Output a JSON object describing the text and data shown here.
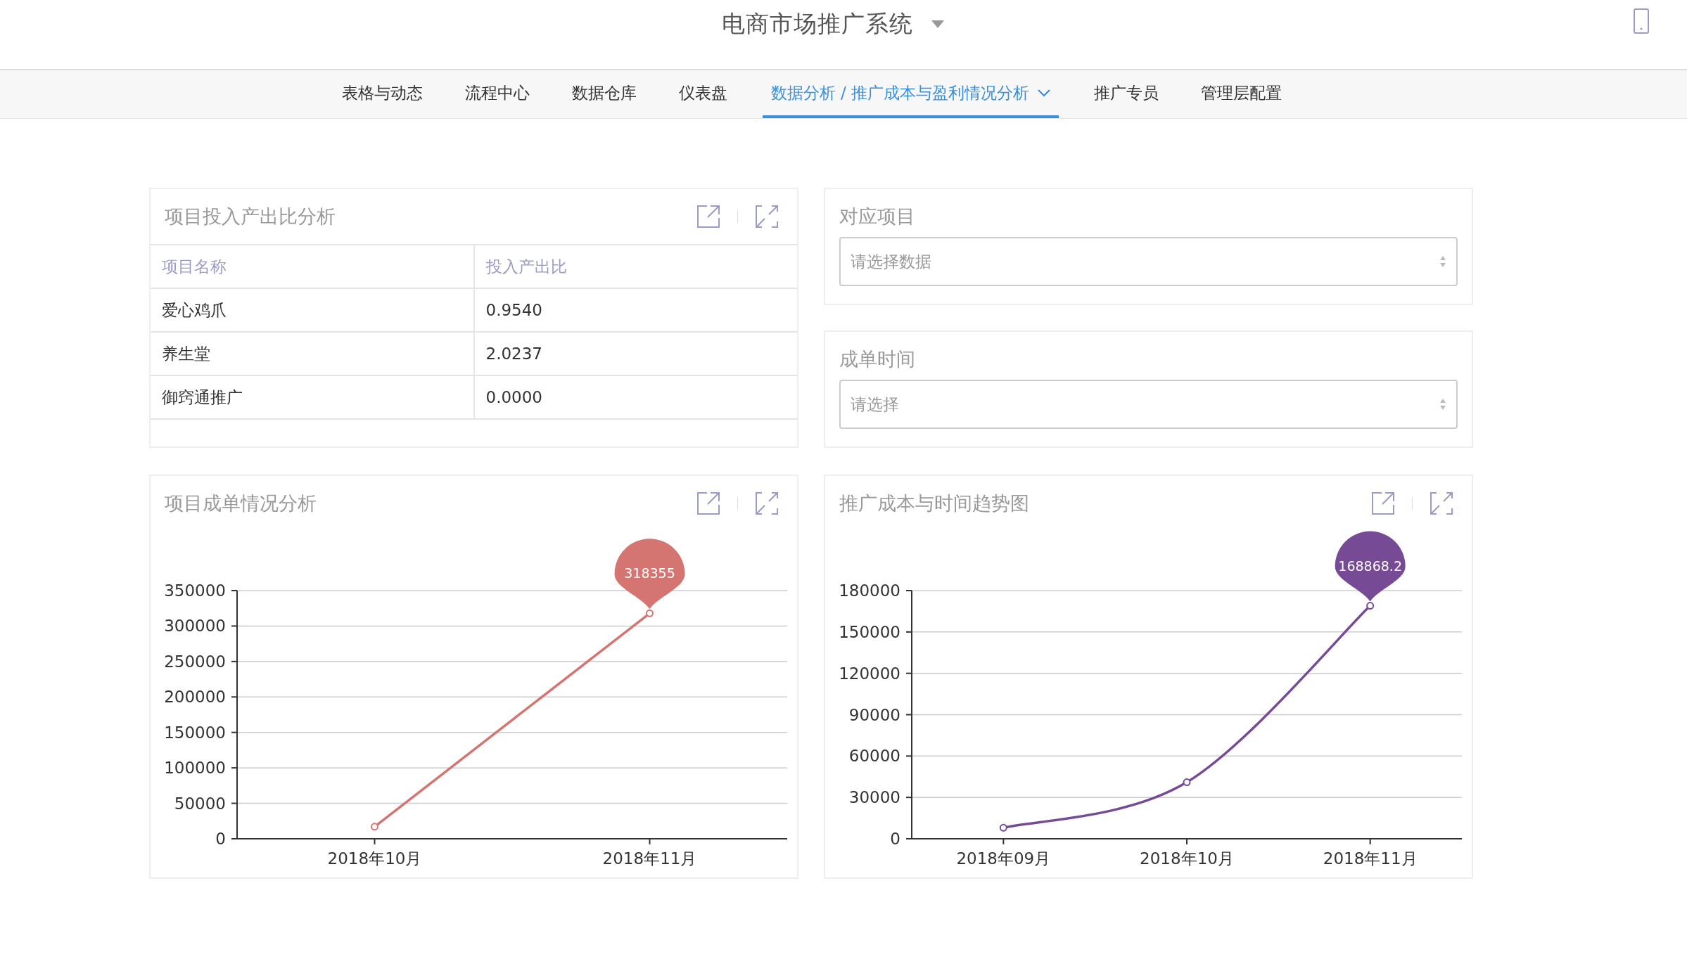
{
  "header": {
    "title": "电商市场推广系统"
  },
  "nav": {
    "tabs": [
      {
        "label": "表格与动态",
        "selected": false
      },
      {
        "label": "流程中心",
        "selected": false
      },
      {
        "label": "数据仓库",
        "selected": false
      },
      {
        "label": "仪表盘",
        "selected": false
      },
      {
        "label": "数据分析 / 推广成本与盈利情况分析",
        "selected": true
      },
      {
        "label": "推广专员",
        "selected": false
      },
      {
        "label": "管理层配置",
        "selected": false
      }
    ]
  },
  "ratio_card": {
    "title": "项目投入产出比分析",
    "columns": [
      "项目名称",
      "投入产出比"
    ],
    "rows": [
      [
        "爱心鸡爪",
        "0.9540"
      ],
      [
        "养生堂",
        "2.0237"
      ],
      [
        "御窍通推广",
        "0.0000"
      ]
    ]
  },
  "filters": [
    {
      "label": "对应项目",
      "placeholder": "请选择数据"
    },
    {
      "label": "成单时间",
      "placeholder": "请选择"
    }
  ],
  "charts": [
    {
      "title": "项目成单情况分析",
      "chart_data": {
        "type": "line",
        "categories": [
          "2018年10月",
          "2018年11月"
        ],
        "series": [
          {
            "color": "#d47572",
            "values": [
              17000,
              318000
            ],
            "marker": "circle"
          }
        ],
        "ylim": [
          0,
          350000
        ],
        "yticks": [
          0,
          50000,
          100000,
          150000,
          200000,
          250000,
          300000,
          350000
        ],
        "grid": true,
        "annotations": [
          {
            "x": "2018年11月",
            "y": 318000,
            "text": "318355"
          }
        ]
      }
    },
    {
      "title": "推广成本与时间趋势图",
      "chart_data": {
        "type": "line",
        "categories": [
          "2018年09月",
          "2018年10月",
          "2018年11月"
        ],
        "series": [
          {
            "color": "#774a96",
            "values": [
              8000,
              41000,
              169000
            ],
            "marker": "circle"
          }
        ],
        "ylim": [
          0,
          180000
        ],
        "yticks": [
          0,
          30000,
          60000,
          90000,
          120000,
          150000,
          180000
        ],
        "grid": true,
        "annotations": [
          {
            "x": "2018年11月",
            "y": 169000,
            "text": "168868.2"
          }
        ]
      }
    }
  ]
}
